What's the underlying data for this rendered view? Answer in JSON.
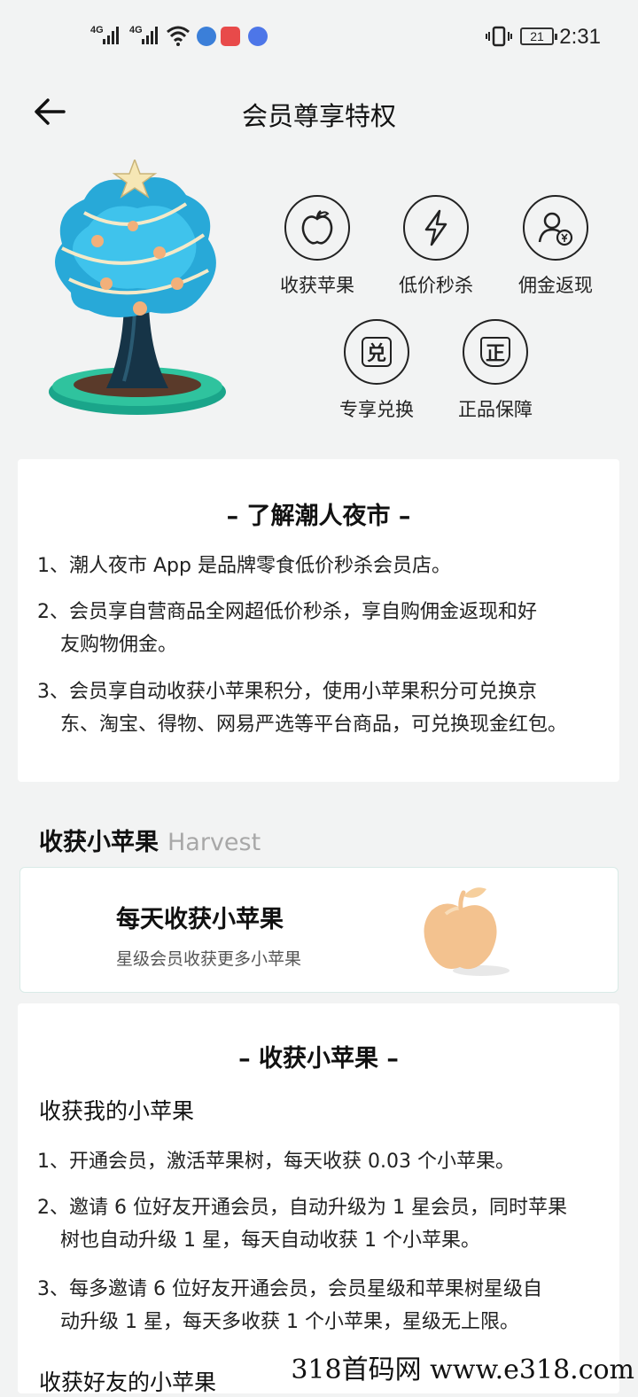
{
  "status_bar": {
    "signal_1": "4G",
    "signal_2": "4G",
    "battery": "21",
    "time": "2:31"
  },
  "header": {
    "title": "会员尊享特权",
    "back_icon": "arrow-left-icon"
  },
  "features": [
    {
      "label": "收获苹果",
      "icon": "apple-icon"
    },
    {
      "label": "低价秒杀",
      "icon": "lightning-icon"
    },
    {
      "label": "佣金返现",
      "icon": "user-cashback-icon"
    },
    {
      "label": "专享兑换",
      "icon": "exchange-icon",
      "glyph": "兑"
    },
    {
      "label": "正品保障",
      "icon": "shield-genuine-icon",
      "glyph": "正"
    }
  ],
  "about": {
    "heading": "– 了解潮人夜市 –",
    "items": [
      {
        "line1": "1、潮人夜市 App 是品牌零食低价秒杀会员店。",
        "line2": ""
      },
      {
        "line1": "2、会员享自营商品全网超低价秒杀，享自购佣金返现和好",
        "line2": "友购物佣金。"
      },
      {
        "line1": "3、会员享自动收获小苹果积分，使用小苹果积分可兑换京",
        "line2": "东、淘宝、得物、网易严选等平台商品，可兑换现金红包。"
      }
    ]
  },
  "harvest_section": {
    "title": "收获小苹果",
    "subtitle": "Harvest"
  },
  "harvest_card": {
    "title": "每天收获小苹果",
    "subtitle": "星级会员收获更多小苹果"
  },
  "rules": {
    "heading": "– 收获小苹果 –",
    "sub_heading": "收获我的小苹果",
    "items": [
      {
        "line1": "1、开通会员，激活苹果树，每天收获 0.03 个小苹果。",
        "line2": ""
      },
      {
        "line1": "2、邀请 6 位好友开通会员，自动升级为 1 星会员，同时苹果",
        "line2": "树也自动升级 1 星，每天自动收获 1 个小苹果。"
      },
      {
        "line1": "3、每多邀请 6 位好友开通会员，会员星级和苹果树星级自",
        "line2": "动升级 1 星，每天多收获 1 个小苹果，星级无上限。"
      }
    ],
    "next_heading": "收获好友的小苹果"
  },
  "watermark": "318首码网 www.e318.com"
}
